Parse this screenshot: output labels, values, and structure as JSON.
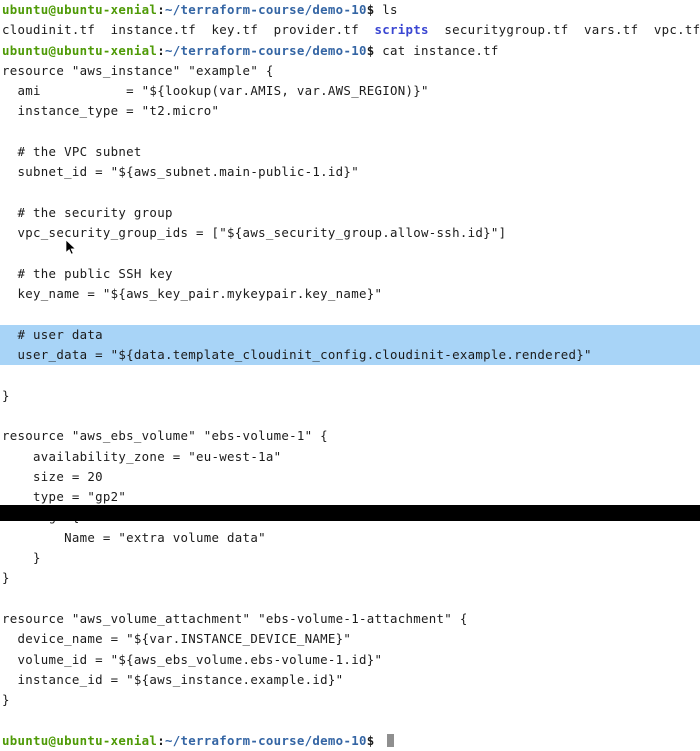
{
  "terminal": {
    "background_color": "#ffffff",
    "foreground_color": "#1b1b1b",
    "selection_color": "#a8d4f7",
    "prompt_user_color": "#4e9a06",
    "prompt_path_color": "#3465a4",
    "directory_color": "#3a46d2",
    "cursor_color": "#8f8f8f",
    "bottom_bar_color": "#000000"
  },
  "prompt": {
    "user_host": "ubuntu@ubuntu-xenial",
    "separator": ":",
    "path": "~/terraform-course/demo-10",
    "sigil": "$"
  },
  "commands": {
    "ls": " ls",
    "cat": " cat instance.tf"
  },
  "ls_output": {
    "before_dir": "cloudinit.tf  instance.tf  key.tf  provider.tf  ",
    "dir": "scripts",
    "after_dir": "  securitygroup.tf  vars.tf  vpc.tf"
  },
  "file_content": {
    "filename": "instance.tf",
    "lines": [
      "resource \"aws_instance\" \"example\" {",
      "  ami           = \"${lookup(var.AMIS, var.AWS_REGION)}\"",
      "  instance_type = \"t2.micro\"",
      "",
      "  # the VPC subnet",
      "  subnet_id = \"${aws_subnet.main-public-1.id}\"",
      "",
      "  # the security group",
      "  vpc_security_group_ids = [\"${aws_security_group.allow-ssh.id}\"]",
      "",
      "  # the public SSH key",
      "  key_name = \"${aws_key_pair.mykeypair.key_name}\"",
      "",
      "  # user data",
      "  user_data = \"${data.template_cloudinit_config.cloudinit-example.rendered}\"",
      "",
      "}",
      "",
      "resource \"aws_ebs_volume\" \"ebs-volume-1\" {",
      "    availability_zone = \"eu-west-1a\"",
      "    size = 20",
      "    type = \"gp2\"",
      "    tags {",
      "        Name = \"extra volume data\"",
      "    }",
      "}",
      "",
      "resource \"aws_volume_attachment\" \"ebs-volume-1-attachment\" {",
      "  device_name = \"${var.INSTANCE_DEVICE_NAME}\"",
      "  volume_id = \"${aws_ebs_volume.ebs-volume-1.id}\"",
      "  instance_id = \"${aws_instance.example.id}\"",
      "}",
      ""
    ],
    "selected_line_indices": [
      13,
      14
    ]
  },
  "final_prompt": {
    "trailing": " "
  }
}
